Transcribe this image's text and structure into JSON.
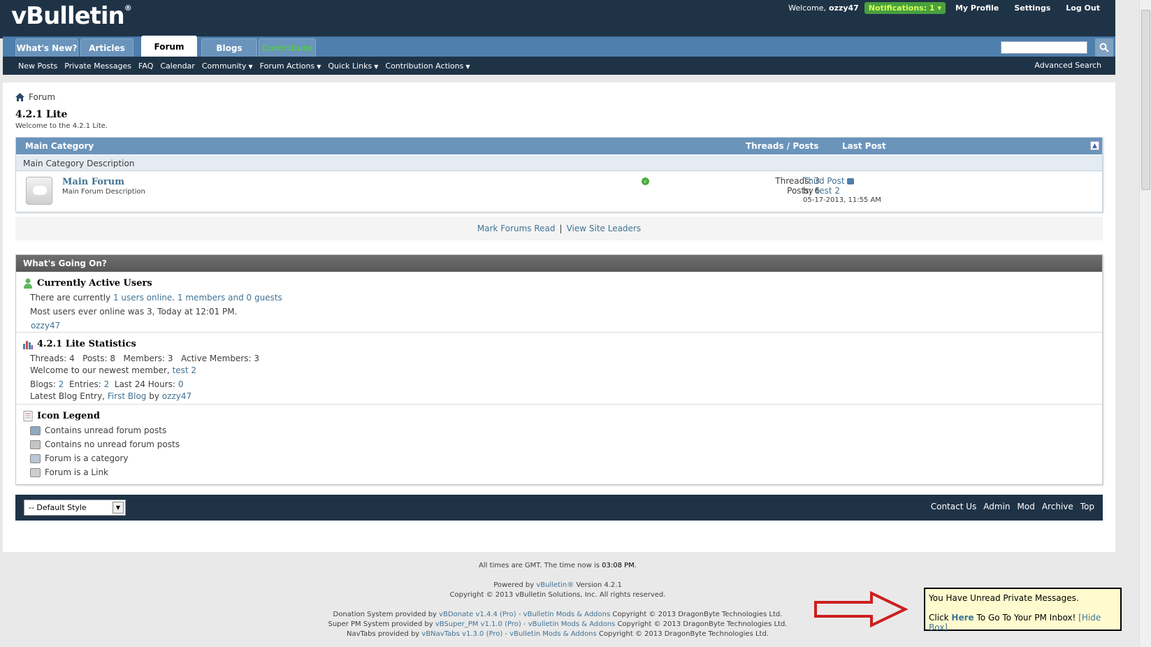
{
  "header": {
    "logo": "vBulletin",
    "logo_mark": "®",
    "welcome_label": "Welcome,",
    "username": "ozzy47",
    "notifications": "Notifications: 1",
    "links": [
      "My Profile",
      "Settings",
      "Log Out"
    ]
  },
  "tabs": [
    "What's New?",
    "Articles",
    "Forum",
    "Blogs",
    "Contribute"
  ],
  "active_tab": "Forum",
  "subnav": {
    "items": [
      {
        "label": "New Posts",
        "dropdown": false
      },
      {
        "label": "Private Messages",
        "dropdown": false
      },
      {
        "label": "FAQ",
        "dropdown": false
      },
      {
        "label": "Calendar",
        "dropdown": false
      },
      {
        "label": "Community",
        "dropdown": true
      },
      {
        "label": "Forum Actions",
        "dropdown": true
      },
      {
        "label": "Quick Links",
        "dropdown": true
      },
      {
        "label": "Contribution Actions",
        "dropdown": true
      }
    ],
    "advanced_search": "Advanced Search"
  },
  "breadcrumb": "Forum",
  "forum": {
    "title": "4.2.1 Lite",
    "description": "Welcome to the 4.2.1 Lite."
  },
  "category": {
    "title": "Main Category",
    "col_threads_posts": "Threads / Posts",
    "col_last_post": "Last Post",
    "description": "Main Category Description",
    "row": {
      "name": "Main Forum",
      "description": "Main Forum Description",
      "threads": "Threads: 3",
      "posts": "Posts: 6",
      "last_post_title": "Third Post",
      "by_label": "by",
      "last_post_user": "test 2",
      "last_post_date": "05-17-2013, 11:55 AM"
    }
  },
  "actions": {
    "mark_read": "Mark Forums Read",
    "separator": "|",
    "site_leaders": "View Site Leaders"
  },
  "wgo": {
    "title": "What's Going On?",
    "users": {
      "title": "Currently Active Users",
      "line1_prefix": "There are currently",
      "line1_link1": "1 users online",
      "line1_dot": ".",
      "line1_link2": "1 members and 0 guests",
      "line2": "Most users ever online was 3, Today at 12:01 PM.",
      "online_user": "ozzy47"
    },
    "stats": {
      "title": "4.2.1 Lite Statistics",
      "line1": "Threads: 4   Posts: 8   Members: 3   Active Members: 3",
      "line2_prefix": "Welcome to our newest member,",
      "newest_member": "test 2",
      "blogs_label": "Blogs:",
      "blogs_value": "2",
      "entries_label": "Entries:",
      "entries_value": "2",
      "last24_label": "Last 24 Hours:",
      "last24_value": "0",
      "latest_prefix": "Latest Blog Entry,",
      "latest_entry": "First Blog",
      "latest_by": "by",
      "latest_user": "ozzy47"
    },
    "legend": {
      "title": "Icon Legend",
      "items": [
        "Contains unread forum posts",
        "Contains no unread forum posts",
        "Forum is a category",
        "Forum is a Link"
      ]
    }
  },
  "footer": {
    "style_selector": "-- Default Style",
    "links": [
      "Contact Us",
      "Admin",
      "Mod",
      "Archive",
      "Top"
    ]
  },
  "copyright": {
    "time_prefix": "All times are GMT. The time now is",
    "time_value": "03:08 PM",
    "time_suffix": ".",
    "powered_prefix": "Powered by",
    "powered_link": "vBulletin®",
    "powered_suffix": "Version 4.2.1",
    "copyright_line": "Copyright © 2013 vBulletin Solutions, Inc. All rights reserved.",
    "donation_prefix": "Donation System provided by",
    "donation_link": "vBDonate v1.4.4 (Pro) - vBulletin Mods & Addons",
    "donation_suffix": "Copyright © 2013 DragonByte Technologies Ltd.",
    "superpm_prefix": "Super PM System provided by",
    "superpm_link": "vBSuper_PM v1.1.0 (Pro) - vBulletin Mods & Addons",
    "superpm_suffix": "Copyright © 2013 DragonByte Technologies Ltd.",
    "navtabs_prefix": "NavTabs provided by",
    "navtabs_link": "vBNavTabs v1.3.0 (Pro) - vBulletin Mods & Addons",
    "navtabs_suffix": "Copyright © 2013 DragonByte Technologies Ltd."
  },
  "pm_notice": {
    "line1": "You Have Unread Private Messages.",
    "click": "Click",
    "here": "Here",
    "rest": "To Go To Your PM Inbox!",
    "hide": "[Hide Box]"
  },
  "colors": {
    "header_bg": "#1f3347",
    "nav_blue": "#4e7fad",
    "link": "#417394",
    "notif_green": "#49a03e",
    "arrow_red": "#cc1f1f",
    "pm_bg": "#fffbcf"
  }
}
